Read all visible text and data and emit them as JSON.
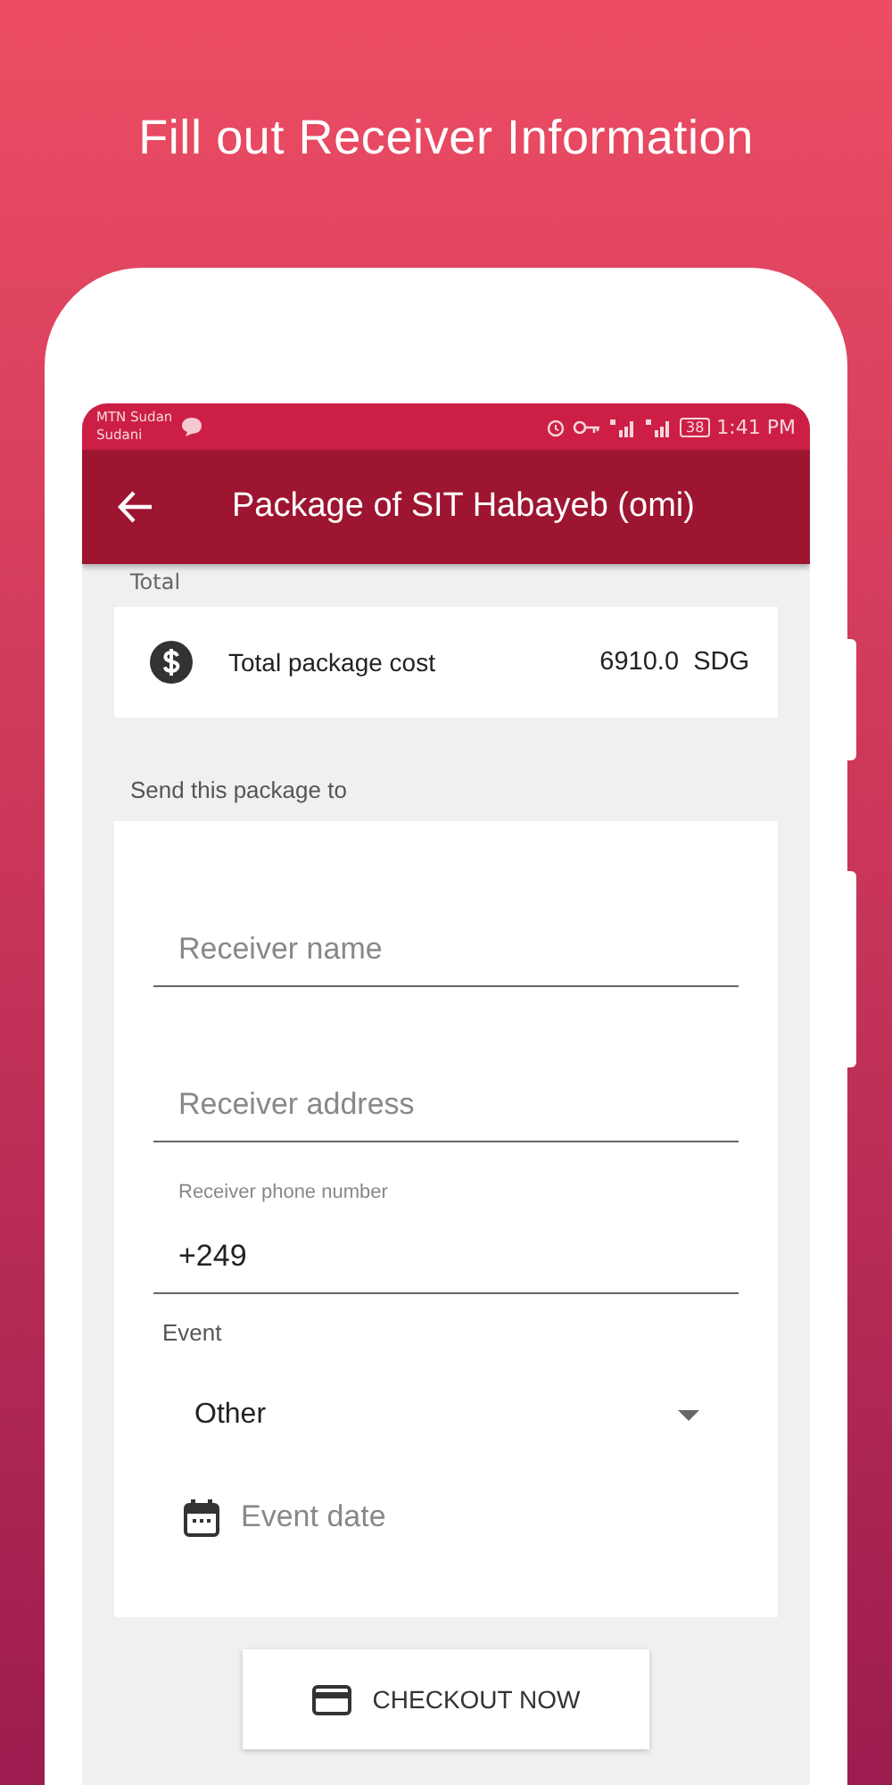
{
  "headline": "Fill out Receiver Information",
  "status_bar": {
    "carrier": [
      "MTN Sudan",
      "Sudani"
    ],
    "battery": "38",
    "time": "1:41 PM"
  },
  "app_bar": {
    "title": "Package of SIT Habayeb (omi)"
  },
  "total": {
    "heading": "Total",
    "label": "Total package cost",
    "amount": "6910.0  SDG"
  },
  "send_heading": "Send this package to",
  "fields": [
    {
      "kind": "text",
      "placeholder": "Receiver name"
    },
    {
      "kind": "text",
      "placeholder": "Receiver address"
    },
    {
      "kind": "filled",
      "label": "Receiver phone number",
      "value": "+249"
    },
    {
      "kind": "select",
      "label": "Event",
      "value": "Other"
    },
    {
      "kind": "date",
      "placeholder": "Event date"
    }
  ],
  "checkout_button": "CHECKOUT NOW"
}
